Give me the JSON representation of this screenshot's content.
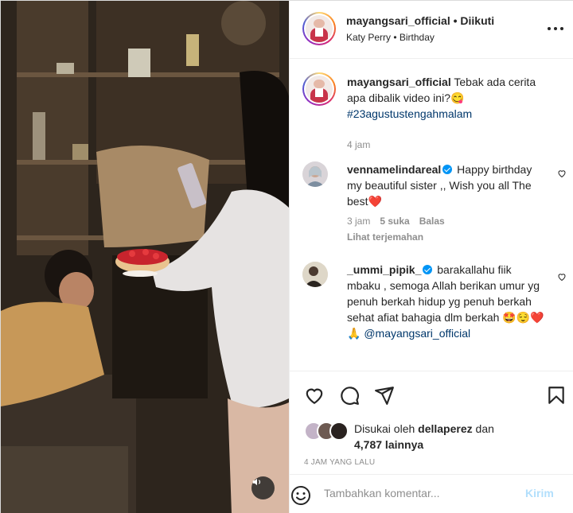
{
  "header": {
    "username": "mayangsari_official",
    "separator": "•",
    "follow_status": "Diikuti",
    "audio": "Katy Perry • Birthday"
  },
  "caption": {
    "username": "mayangsari_official",
    "text": "Tebak ada cerita apa dibalik video ini?😋",
    "hashtag": "#23agustustengahmalam",
    "time": "4 jam"
  },
  "comments": [
    {
      "username": "vennamelindareal",
      "verified": true,
      "text": "Happy birthday my beautiful sister ,, Wish you all The best❤️",
      "time": "3 jam",
      "likes": "5 suka",
      "reply": "Balas",
      "translate": "Lihat terjemahan"
    },
    {
      "username": "_ummi_pipik_",
      "verified": true,
      "text": "barakallahu fiik mbaku , semoga Allah berikan umur yg penuh berkah hidup yg penuh berkah sehat afiat bahagia dlm berkah 🤩😌❤️🙏",
      "mention": "@mayangsari_official"
    }
  ],
  "likes": {
    "prefix": "Disukai oleh",
    "user": "dellaperez",
    "conj": "dan",
    "count": "4,787 lainnya"
  },
  "time_ago": "4 JAM YANG LALU",
  "add_comment": {
    "placeholder": "Tambahkan komentar...",
    "post_label": "Kirim"
  },
  "colors": {
    "link": "#00376b",
    "verified": "#0095f6",
    "post_disabled": "#b2dffc",
    "heart": "#e0245e"
  }
}
